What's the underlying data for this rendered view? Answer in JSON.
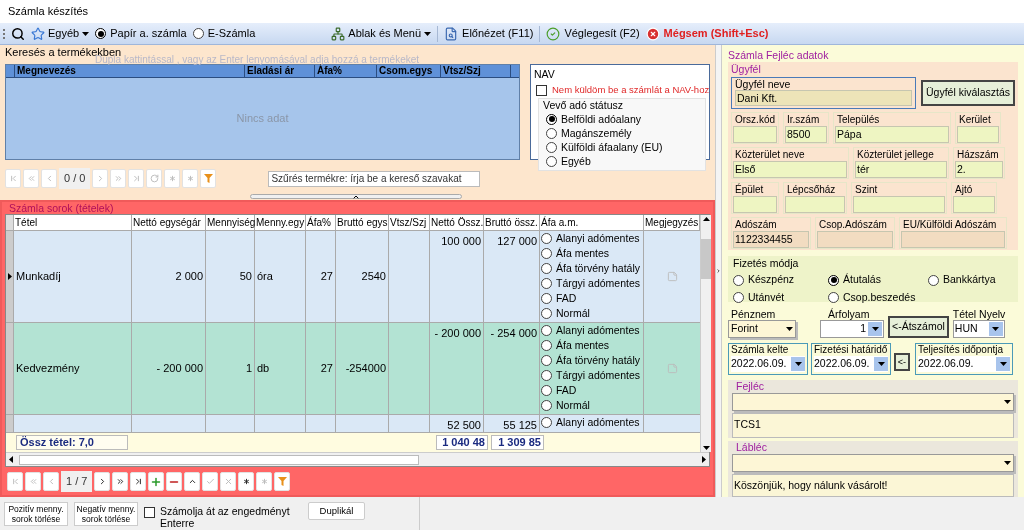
{
  "window": {
    "title": "Számla készítés"
  },
  "toolbar": [
    {
      "kind": "search"
    },
    {
      "kind": "other_menu",
      "label": "Egyéb"
    },
    {
      "kind": "radio",
      "label": "Papír a. számla",
      "selected": true
    },
    {
      "kind": "radio",
      "label": "E-Számla",
      "selected": false
    },
    {
      "kind": "window_menu",
      "label": "Ablak és Menü"
    },
    {
      "kind": "preview",
      "label": "Előnézet (F11)"
    },
    {
      "kind": "finalize",
      "label": "Véglegesít (F2)"
    },
    {
      "kind": "cancel",
      "label": "Mégsem (Shift+Esc)"
    }
  ],
  "search_panel": {
    "title": "Keresés a termékekben",
    "hint": "Dupla kattintással , vagy az Enter lenyomásával adja hozzá a termékeket",
    "columns": [
      "Megnevezés",
      "Eladási ár",
      "Áfa%",
      "Csom.egys",
      "Vtsz/Szj"
    ],
    "empty_text": "Nincs adat",
    "nav": {
      "title": "NAV",
      "no_send": {
        "label": "Nem küldöm be a számlát a NAV-hoz",
        "checked": false
      },
      "buyer_status": {
        "title": "Vevő adó státusz",
        "options": [
          {
            "label": "Belföldi adóalany",
            "selected": true
          },
          {
            "label": "Magánszemély",
            "selected": false
          },
          {
            "label": "Külföldi áfaalany (EU)",
            "selected": false
          },
          {
            "label": "Egyéb",
            "selected": false
          }
        ]
      }
    },
    "pager": {
      "position": "0 / 0",
      "buttons": [
        {
          "kind": "first",
          "disabled": true
        },
        {
          "kind": "prev_page",
          "disabled": true
        },
        {
          "kind": "prev",
          "disabled": true
        },
        {
          "kind": "next",
          "disabled": true
        },
        {
          "kind": "next_page",
          "disabled": true
        },
        {
          "kind": "last",
          "disabled": true
        },
        {
          "kind": "refresh",
          "disabled": true
        },
        {
          "kind": "new",
          "disabled": true
        },
        {
          "kind": "new_copy",
          "disabled": true
        },
        {
          "kind": "filter",
          "disabled": false
        }
      ]
    },
    "filter": {
      "placeholder": "Szűrés termékre: írja be a kereső szavakat"
    }
  },
  "lines_panel": {
    "title": "Számla sorok (tételek)",
    "columns": [
      "Tétel",
      "Nettó egységár",
      "Mennyiség",
      "Menny.egy",
      "Áfa%",
      "Bruttó egys",
      "Vtsz/Szj",
      "Nettó Össz.",
      "Bruttó össz.",
      "Áfa a.m.",
      "Megjegyzés"
    ],
    "rows": [
      {
        "current": true,
        "color": "#dae8f6",
        "item": "Munkadíj",
        "unit_price": "2 000",
        "qty": "50",
        "unit": "óra",
        "vat": "27",
        "gross_unit": "2540",
        "net_total": "100 000",
        "gross_total": "127 000",
        "has_note": true,
        "vat_exemptions": [
          {
            "label": "Alanyi adómentes",
            "selected": false
          },
          {
            "label": "Áfa mentes",
            "selected": false
          },
          {
            "label": "Áfa törvény hatály",
            "selected": false
          },
          {
            "label": "Tárgyi adómentes",
            "selected": false
          },
          {
            "label": "FAD",
            "selected": false
          },
          {
            "label": "Normál",
            "selected": false
          }
        ]
      },
      {
        "current": false,
        "color": "#b3e3d3",
        "item": "Kedvezmény",
        "unit_price": "- 200 000",
        "qty": "1",
        "unit": "db",
        "vat": "27",
        "gross_unit": "-254000",
        "net_total": "- 200 000",
        "gross_total": "- 254 000",
        "has_note": true,
        "vat_exemptions": [
          {
            "label": "Alanyi adómentes",
            "selected": false
          },
          {
            "label": "Áfa mentes",
            "selected": false
          },
          {
            "label": "Áfa törvény hatály",
            "selected": false
          },
          {
            "label": "Tárgyi adómentes",
            "selected": false
          },
          {
            "label": "FAD",
            "selected": false
          },
          {
            "label": "Normál",
            "selected": false
          }
        ]
      },
      {
        "current": false,
        "color": "#dae8f6",
        "net_total": "52 500",
        "gross_total": "55 125",
        "has_note": false,
        "vat_exemptions": [
          {
            "label": "Alanyi adómentes",
            "selected": false
          }
        ]
      }
    ],
    "summary": {
      "count": "Össz tétel: 7,0",
      "net_total": "1 040 48",
      "gross_total": "1 309 85"
    },
    "pager": {
      "position": "1 / 7",
      "buttons": [
        {
          "kind": "first",
          "disabled": true
        },
        {
          "kind": "prev_page",
          "disabled": true
        },
        {
          "kind": "prev",
          "disabled": true
        },
        {
          "kind": "next",
          "disabled": false
        },
        {
          "kind": "next_page",
          "disabled": false
        },
        {
          "kind": "last",
          "disabled": false
        },
        {
          "kind": "add",
          "disabled": false
        },
        {
          "kind": "remove",
          "disabled": false
        },
        {
          "kind": "up",
          "disabled": false
        },
        {
          "kind": "confirm",
          "disabled": true
        },
        {
          "kind": "cancel",
          "disabled": true
        },
        {
          "kind": "new",
          "disabled": false
        },
        {
          "kind": "new_copy",
          "disabled": true
        },
        {
          "kind": "filter",
          "disabled": false
        }
      ]
    }
  },
  "bottom_bar": {
    "delete_positive": "Pozitív menny. sorok törlése",
    "delete_negative": "Negatív menny. sorok törlése",
    "recalc": {
      "label": "Számolja át az engedményt Enterre",
      "checked": false
    },
    "duplicate": "Duplikál"
  },
  "header_panel": {
    "title": "Számla Fejléc adatok",
    "customer": {
      "title": "Ügyfél",
      "name": {
        "label": "Ügyfél neve",
        "value": "Dani Kft."
      },
      "select_button": "Ügyfél kiválasztás",
      "fields": [
        {
          "label": "Orsz.kód",
          "readonly": false
        },
        {
          "label": "Ir.szám",
          "value": "8500",
          "readonly": false
        },
        {
          "label": "Település",
          "value": "Pápa",
          "readonly": false
        },
        {
          "label": "Kerület",
          "readonly": false
        },
        {
          "label": "Közterület neve",
          "value": "Első",
          "readonly": false
        },
        {
          "label": "Közterület jellege",
          "value": "tér",
          "readonly": false
        },
        {
          "label": "Házszám",
          "value": "2.",
          "readonly": false
        },
        {
          "label": "Épület",
          "readonly": false
        },
        {
          "label": "Lépcsőház",
          "readonly": false
        },
        {
          "label": "Szint",
          "readonly": false
        },
        {
          "label": "Ajtó",
          "readonly": false
        },
        {
          "label": "Adószám",
          "value": "1122334455",
          "readonly": true
        },
        {
          "label": "Csop.Adószám",
          "readonly": true
        },
        {
          "label": "EU/Külföldi Adószám",
          "readonly": true
        }
      ]
    },
    "payment": {
      "title": "Fizetés módja",
      "options": [
        {
          "label": "Készpénz",
          "selected": false
        },
        {
          "label": "Átutalás",
          "selected": true
        },
        {
          "label": "Bankkártya",
          "selected": false
        },
        {
          "label": "Utánvét",
          "selected": false
        },
        {
          "label": "Csop.beszedés",
          "selected": false
        }
      ]
    },
    "currency": {
      "label": "Pénznem",
      "value": "Forint"
    },
    "rate": {
      "label": "Árfolyam",
      "value": "1"
    },
    "convert_button": "<-Átszámol",
    "language": {
      "label": "Tétel Nyelv",
      "value": "HUN"
    },
    "dates": [
      {
        "label": "Számla kelte",
        "value": "2022.06.09."
      },
      {
        "label": "Fizetési határidő",
        "value": "2022.06.09."
      },
      {
        "label": "Teljesítés időpontja",
        "value": "2022.06.09."
      }
    ],
    "copy_date_button": "<-",
    "header_text": {
      "title": "Fejléc",
      "text": "TCS1"
    },
    "footer_text": {
      "title": "Lábléc",
      "text": "Köszönjük, hogy nálunk vásárolt!"
    }
  }
}
